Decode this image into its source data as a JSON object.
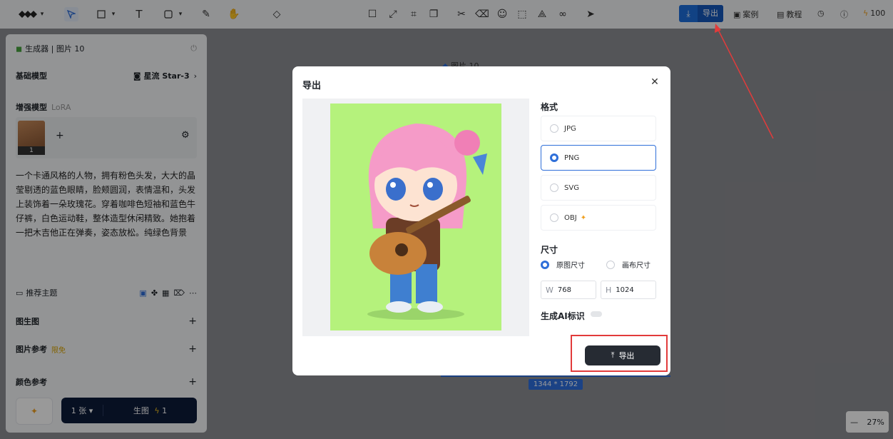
{
  "toolbar": {
    "export_label": "导出",
    "case_label": "案例",
    "tutorial_label": "教程",
    "credits": "100"
  },
  "panel": {
    "header": "生成器 | 图片 10",
    "base_model_label": "基础模型",
    "base_model_value": "星流 Star-3",
    "enhance_label": "增强模型",
    "enhance_sub": "LoRA",
    "lora_count": "1",
    "prompt": "一个卡通风格的人物，拥有粉色头发，大大的晶莹剔透的蓝色眼睛，脸颊圆润，表情温和，头发上装饰着一朵玫瑰花。穿着咖啡色短袖和蓝色牛仔裤，白色运动鞋，整体造型休闲精致。她抱着一把木吉他正在弹奏，姿态放松。纯绿色背景",
    "recommend_label": "推荐主题",
    "img2img_label": "图生图",
    "img_ref_label": "图片参考",
    "img_ref_badge": "限免",
    "color_ref_label": "颜色参考",
    "count_label": "1 张",
    "generate_label": "生图",
    "generate_cost": "1"
  },
  "canvas": {
    "image_label": "图片 10",
    "size_tag": "1344 * 1792",
    "zoom": "27%",
    "zoom_minus": "—"
  },
  "modal": {
    "title": "导出",
    "format_label": "格式",
    "formats": [
      "JPG",
      "PNG",
      "SVG",
      "OBJ"
    ],
    "selected_format": "PNG",
    "size_label": "尺寸",
    "size_options": [
      "原图尺寸",
      "画布尺寸"
    ],
    "width_key": "W",
    "width_value": "768",
    "height_key": "H",
    "height_value": "1024",
    "ai_mark_label": "生成AI标识",
    "export_button": "导出"
  },
  "colors": {
    "accent": "#2f6fd9",
    "annotation": "#e23b3b",
    "image_bg": "#b5f27c"
  }
}
